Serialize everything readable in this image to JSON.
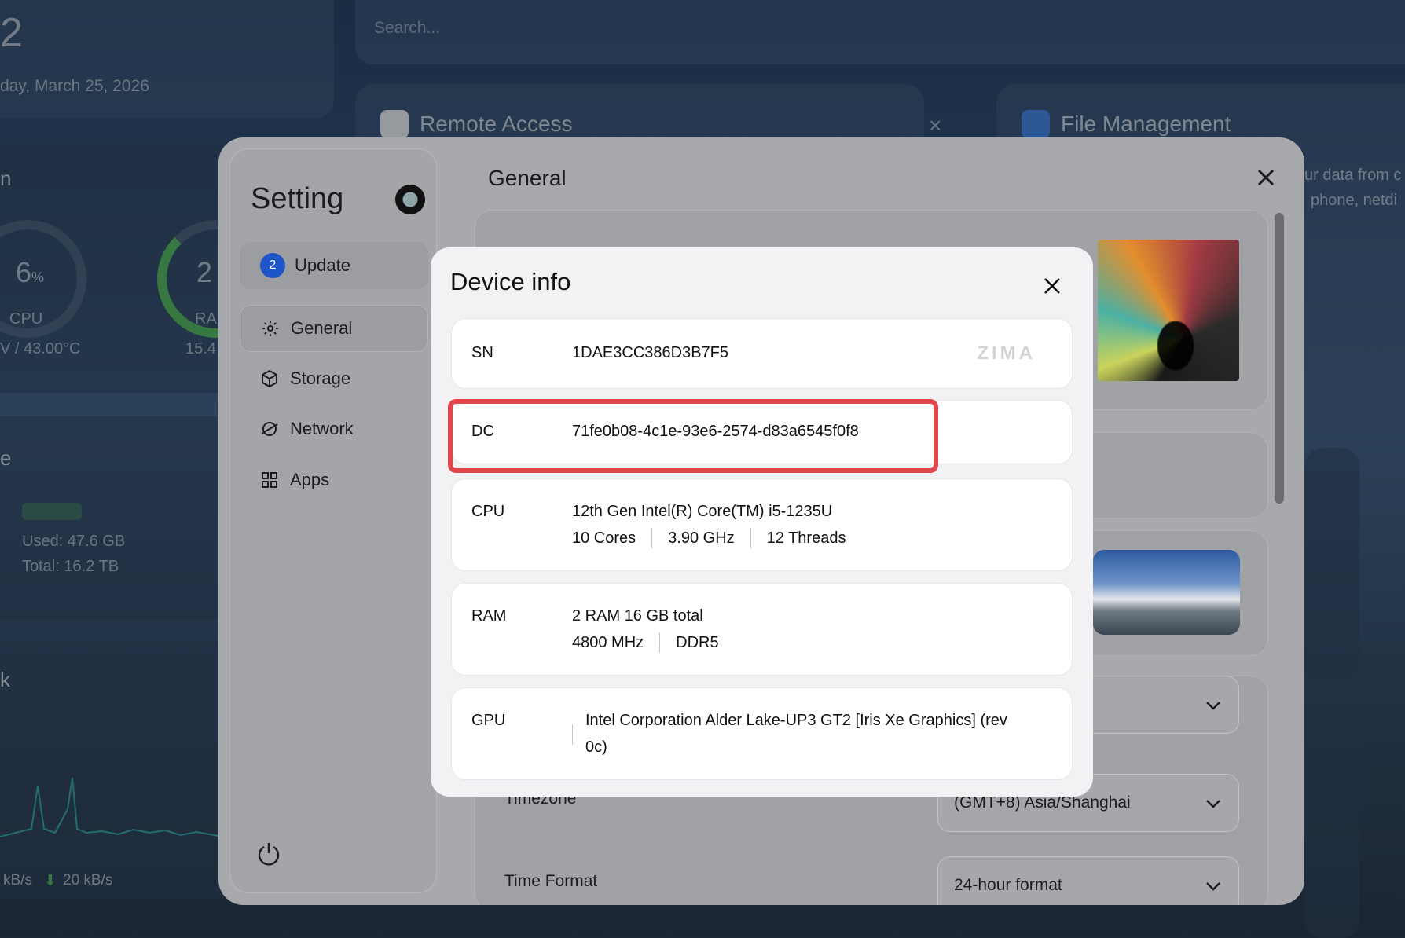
{
  "background": {
    "date_number": "2",
    "date_text": "day, March 25, 2026",
    "search_placeholder": "Search...",
    "remote_access_title": "Remote Access",
    "file_management_title": "File Management",
    "file_desc_line1": "ur data from c",
    "file_desc_line2": "phone, netdi",
    "cpu_percent": "6",
    "cpu_unit": "%",
    "cpu_label": "CPU",
    "cpu_temp": "V / 43.00°C",
    "ram_percent": "2",
    "ram_label": "RA",
    "ram_value": "15.4",
    "section_a": "n",
    "section_storage": "e",
    "storage_used": "Used: 47.6 GB",
    "storage_total": "Total: 16.2 TB",
    "section_network": "k",
    "upload_speed": "kB/s",
    "download_speed": "20 kB/s"
  },
  "settings": {
    "title": "Setting",
    "update_label": "Update",
    "update_count": "2",
    "nav": [
      {
        "label": "General",
        "icon": "gear-icon",
        "active": true
      },
      {
        "label": "Storage",
        "icon": "cube-icon",
        "active": false
      },
      {
        "label": "Network",
        "icon": "globe-icon",
        "active": false
      },
      {
        "label": "Apps",
        "icon": "grid-icon",
        "active": false
      }
    ],
    "main_title": "General",
    "rows": {
      "timezone_label": "Timezone",
      "timezone_value": "(GMT+8) Asia/Shanghai",
      "time_format_label": "Time Format",
      "time_format_value": "24-hour format"
    }
  },
  "device_info": {
    "title": "Device info",
    "sn_label": "SN",
    "sn_value": "1DAE3CC386D3B7F5",
    "logo_text": "ZIMA",
    "dc_label": "DC",
    "dc_value": "71fe0b08-4c1e-93e6-2574-d83a6545f0f8",
    "cpu_label": "CPU",
    "cpu_model": "12th Gen Intel(R) Core(TM) i5-1235U",
    "cpu_cores": "10 Cores",
    "cpu_freq": "3.90 GHz",
    "cpu_threads": "12 Threads",
    "ram_label": "RAM",
    "ram_summary": "2 RAM 16 GB total",
    "ram_speed": "4800 MHz",
    "ram_type": "DDR5",
    "gpu_label": "GPU",
    "gpu_line1": "Intel Corporation Alder Lake-UP3 GT2 [Iris Xe Graphics] (rev",
    "gpu_line2": "0c)"
  },
  "colors": {
    "highlight": "#e0474c",
    "update_badge": "#1e56c9",
    "cpu_gauge": "#4caf50"
  }
}
